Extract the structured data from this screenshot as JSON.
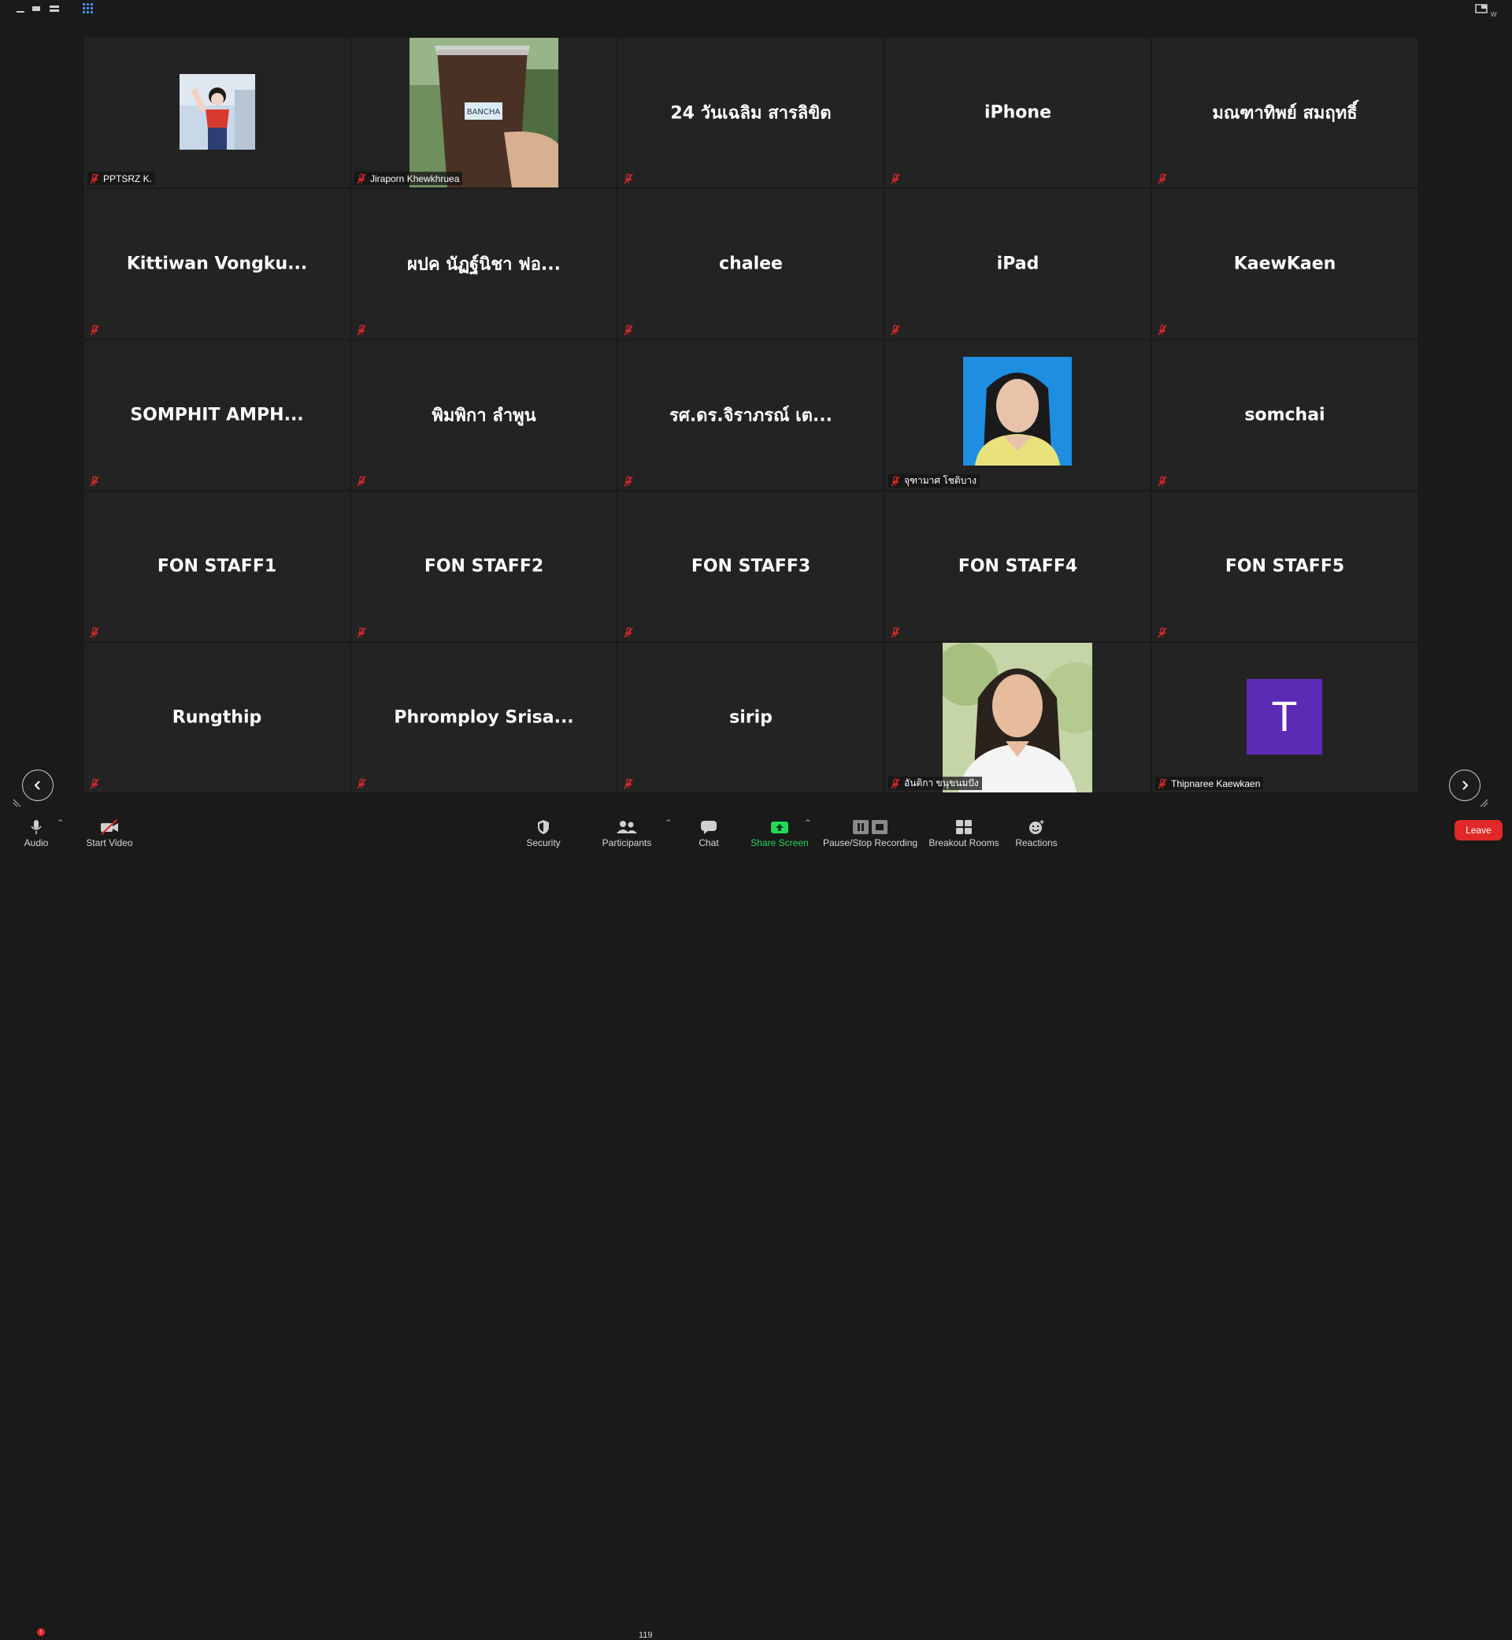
{
  "window": {
    "top_right_initial": "W"
  },
  "participants": [
    {
      "name": "PPTSRZ K.",
      "display": "photo"
    },
    {
      "name": "Jiraporn Khewkhruea",
      "display": "photo"
    },
    {
      "name": "24 วันเฉลิม สารลิขิต",
      "display": "name"
    },
    {
      "name": "iPhone",
      "display": "name"
    },
    {
      "name": "มณฑาทิพย์ สมฤทธิ์",
      "display": "name"
    },
    {
      "name": "Kittiwan  Vongku...",
      "display": "name"
    },
    {
      "name": "ผปค นัฏฐ์นิชา ฟอ...",
      "display": "name"
    },
    {
      "name": "chalee",
      "display": "name"
    },
    {
      "name": "iPad",
      "display": "name"
    },
    {
      "name": "KaewKaen",
      "display": "name"
    },
    {
      "name": "SOMPHIT  AMPH...",
      "display": "name"
    },
    {
      "name": "พิมพิกา ลำพูน",
      "display": "name"
    },
    {
      "name": "รศ.ดร.จิราภรณ์ เต...",
      "display": "name"
    },
    {
      "name": "จุฑามาศ โชติบาง",
      "display": "photo"
    },
    {
      "name": "somchai",
      "display": "name"
    },
    {
      "name": "FON STAFF1",
      "display": "name"
    },
    {
      "name": "FON STAFF2",
      "display": "name"
    },
    {
      "name": "FON STAFF3",
      "display": "name"
    },
    {
      "name": "FON STAFF4",
      "display": "name"
    },
    {
      "name": "FON STAFF5",
      "display": "name"
    },
    {
      "name": "Rungthip",
      "display": "name"
    },
    {
      "name": "Phromploy  Srisa...",
      "display": "name"
    },
    {
      "name": "sirip",
      "display": "name"
    },
    {
      "name": "อันติกา ขนุขนมปัง",
      "display": "photo"
    },
    {
      "name": "Thipnaree Kaewkaen",
      "display": "avatar",
      "avatar_letter": "T",
      "avatar_color": "#5b2bb5"
    }
  ],
  "photo_texts": {
    "cup_label": "BANCHA"
  },
  "toolbar": {
    "audio_label": "Audio",
    "audio_badge": "!",
    "start_video_label": "Start Video",
    "security_label": "Security",
    "participants_label": "Participants",
    "participants_count": "119",
    "chat_label": "Chat",
    "share_screen_label": "Share Screen",
    "pause_recording_label": "Pause/Stop Recording",
    "breakout_label": "Breakout Rooms",
    "reactions_label": "Reactions",
    "leave_label": "Leave"
  },
  "colors": {
    "leave": "#e02828",
    "share_screen": "#23d959",
    "muted": "#e02828",
    "view_accent": "#4a8cff"
  }
}
